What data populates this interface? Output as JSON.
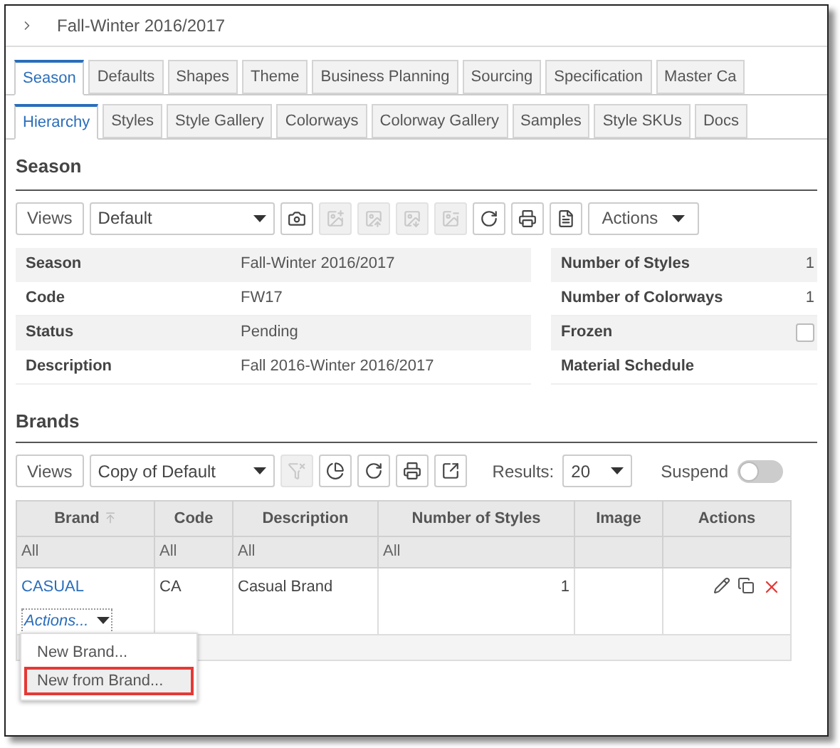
{
  "window": {
    "title": "Fall-Winter 2016/2017"
  },
  "tabs": [
    {
      "label": "Season",
      "selected": true
    },
    {
      "label": "Defaults",
      "selected": false
    },
    {
      "label": "Shapes",
      "selected": false
    },
    {
      "label": "Theme",
      "selected": false
    },
    {
      "label": "Business Planning",
      "selected": false
    },
    {
      "label": "Sourcing",
      "selected": false
    },
    {
      "label": "Specification",
      "selected": false
    },
    {
      "label": "Master Ca",
      "selected": false
    }
  ],
  "subtabs": [
    {
      "label": "Hierarchy",
      "selected": true
    },
    {
      "label": "Styles",
      "selected": false
    },
    {
      "label": "Style Gallery",
      "selected": false
    },
    {
      "label": "Colorways",
      "selected": false
    },
    {
      "label": "Colorway Gallery",
      "selected": false
    },
    {
      "label": "Samples",
      "selected": false
    },
    {
      "label": "Style SKUs",
      "selected": false
    },
    {
      "label": "Docs",
      "selected": false
    }
  ],
  "season": {
    "heading": "Season",
    "toolbar": {
      "views": "Views",
      "view": "Default",
      "icon_buttons": [
        {
          "kind": "camera",
          "disabled": false
        },
        {
          "kind": "image-check",
          "disabled": true
        },
        {
          "kind": "image-left",
          "disabled": true
        },
        {
          "kind": "image-right",
          "disabled": true
        },
        {
          "kind": "image-remove",
          "disabled": true
        },
        {
          "kind": "refresh",
          "disabled": false
        },
        {
          "kind": "print",
          "disabled": false
        },
        {
          "kind": "pdf",
          "disabled": false
        }
      ],
      "actions": "Actions"
    },
    "fields": [
      {
        "label": "Season",
        "value": "Fall-Winter 2016/2017"
      },
      {
        "label": "Code",
        "value": "FW17"
      },
      {
        "label": "Status",
        "value": "Pending"
      },
      {
        "label": "Description",
        "value": "Fall 2016-Winter 2016/2017"
      }
    ],
    "side_fields": [
      {
        "kind": "text",
        "label": "Number of Styles",
        "value": "1"
      },
      {
        "kind": "text",
        "label": "Number of Colorways",
        "value": "1"
      },
      {
        "kind": "checkbox",
        "label": "Frozen",
        "checked": false
      },
      {
        "kind": "text",
        "label": "Material Schedule"
      }
    ]
  },
  "brands": {
    "heading": "Brands",
    "toolbar": {
      "views": "Views",
      "view": "Copy of Default",
      "icon_buttons": [
        {
          "kind": "filter-clear",
          "disabled": true
        },
        {
          "kind": "chart",
          "disabled": false
        },
        {
          "kind": "refresh",
          "disabled": false
        },
        {
          "kind": "print",
          "disabled": false
        },
        {
          "kind": "export",
          "disabled": false
        }
      ],
      "results_label": "Results:",
      "results": "20",
      "suspend_label": "Suspend",
      "suspend_on": false
    },
    "table": {
      "columns": [
        "Brand",
        "Code",
        "Description",
        "Number of Styles",
        "Image",
        "Actions"
      ],
      "filters": [
        "All",
        "All",
        "All",
        "All"
      ],
      "rows": [
        {
          "brand": "CASUAL",
          "code": "CA",
          "description": "Casual Brand",
          "styles": "1"
        }
      ]
    },
    "row_actions": "Actions...",
    "menu": [
      {
        "label": "New Brand...",
        "selected": false
      },
      {
        "label": "New from Brand...",
        "selected": true
      }
    ]
  }
}
